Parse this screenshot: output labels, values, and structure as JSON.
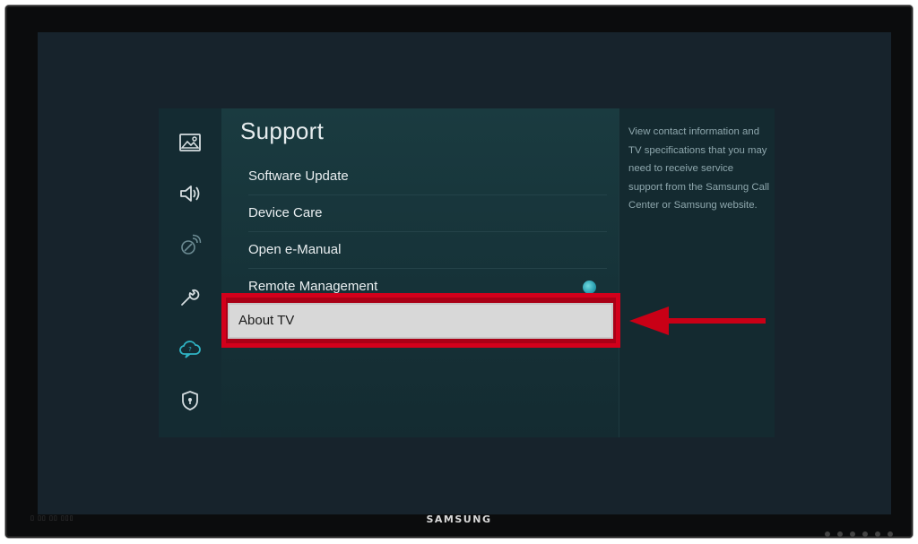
{
  "tv": {
    "brand": "SAMSUNG",
    "bezel_marks": "▯ ▯▯ ▯▯ ▯▯▯"
  },
  "sidebar": {
    "items": [
      {
        "name": "picture-icon"
      },
      {
        "name": "sound-icon"
      },
      {
        "name": "broadcasting-icon"
      },
      {
        "name": "general-wrench-icon"
      },
      {
        "name": "support-cloud-icon"
      },
      {
        "name": "privacy-shield-icon"
      }
    ]
  },
  "menu": {
    "title": "Support",
    "items": [
      {
        "label": "Software Update"
      },
      {
        "label": "Device Care"
      },
      {
        "label": "Open e-Manual"
      },
      {
        "label": "Remote Management"
      }
    ],
    "selected_label": "About TV"
  },
  "description": {
    "text": "View contact information and TV specifications that you may need to receive service support from the Samsung Call Center or Samsung website."
  },
  "colors": {
    "highlight": "#d3001b",
    "arrow": "#c90016",
    "selected_bg": "#d8d8d8"
  }
}
